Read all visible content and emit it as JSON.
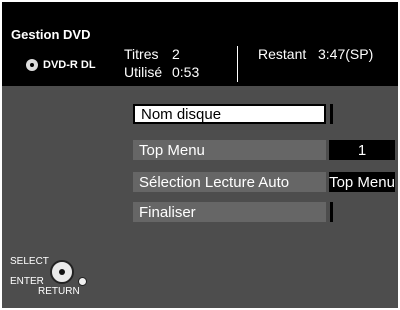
{
  "app": {
    "title": "Gestion DVD",
    "disc_type": "DVD-R DL"
  },
  "info": {
    "titles_label": "Titres",
    "titles_value": "2",
    "used_label": "Utilisé",
    "used_value": "0:53",
    "remaining_label": "Restant",
    "remaining_value": "3:47(SP)"
  },
  "menu": {
    "items": [
      {
        "label": "Nom disque",
        "value": ""
      },
      {
        "label": "Top Menu",
        "value": "1"
      },
      {
        "label": "Sélection Lecture Auto",
        "value": "Top Menu"
      },
      {
        "label": "Finaliser",
        "value": ""
      }
    ]
  },
  "controls": {
    "select_label": "SELECT",
    "enter_label": "ENTER",
    "return_label": "RETURN"
  },
  "colors": {
    "background": "#ffffff",
    "header_bg": "#000000",
    "body_bg": "#4d4d4d",
    "item_bg": "#666666",
    "selected_bg": "#ffffff"
  }
}
